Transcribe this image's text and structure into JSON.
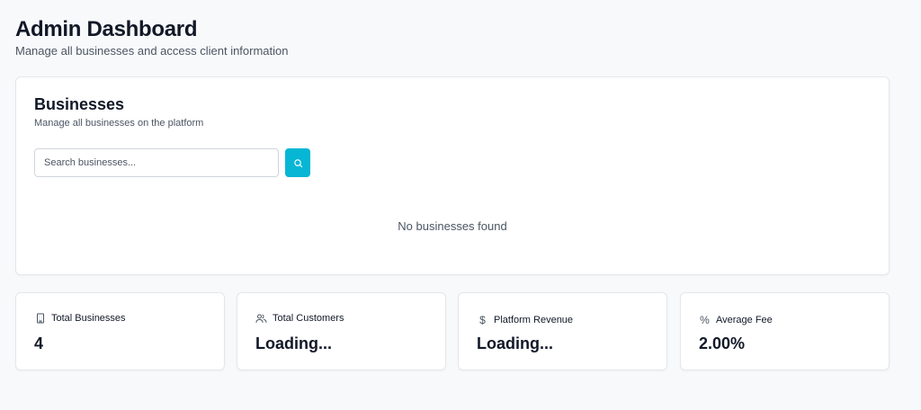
{
  "header": {
    "title": "Admin Dashboard",
    "subtitle": "Manage all businesses and access client information"
  },
  "businesses": {
    "title": "Businesses",
    "description": "Manage all businesses on the platform",
    "search_placeholder": "Search businesses...",
    "empty_text": "No businesses found"
  },
  "stats": [
    {
      "icon": "building-icon",
      "label": "Total Businesses",
      "value": "4"
    },
    {
      "icon": "users-icon",
      "label": "Total Customers",
      "value": "Loading..."
    },
    {
      "icon": "dollar-icon",
      "label": "Platform Revenue",
      "value": "Loading..."
    },
    {
      "icon": "percent-icon",
      "label": "Average Fee",
      "value": "2.00%"
    }
  ],
  "colors": {
    "accent": "#06b6d4",
    "background": "#f8f9fa",
    "card": "#ffffff",
    "border": "#e5e7eb",
    "muted_text": "#4b5563"
  }
}
